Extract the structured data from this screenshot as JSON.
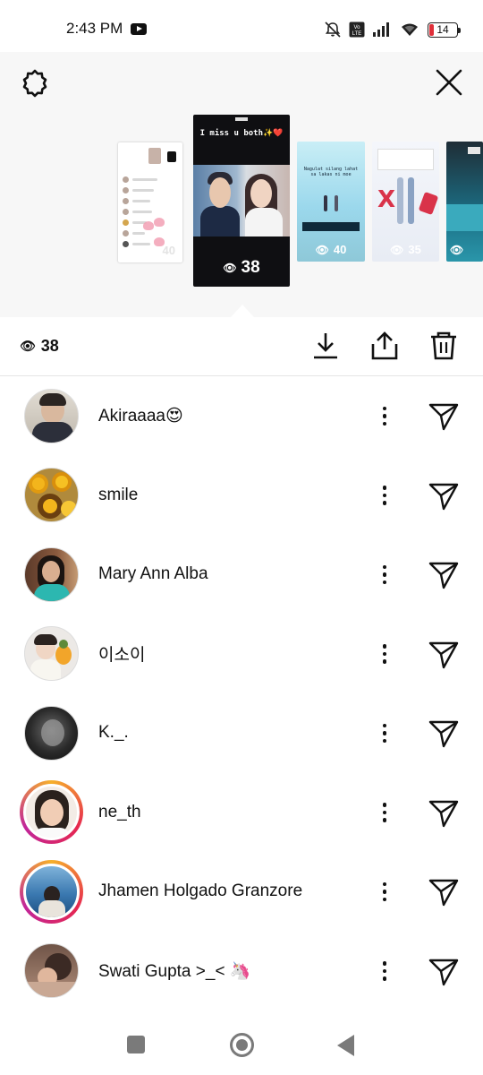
{
  "status_bar": {
    "time": "2:43 PM",
    "battery_level": "14",
    "icons": [
      "youtube-icon",
      "mute-icon",
      "volte-icon",
      "signal-icon",
      "wifi-icon",
      "battery-icon"
    ]
  },
  "header": {
    "settings_icon": "gear-icon",
    "close_icon": "close-icon"
  },
  "stories": [
    {
      "views": "40",
      "theme": "viewer-list-screenshot"
    },
    {
      "views": "38",
      "caption": "I miss u both✨❤️",
      "selected": true
    },
    {
      "views": "40",
      "caption": "Nagulat silang lahat sa lakas ni moe"
    },
    {
      "views": "35"
    },
    {
      "views": ""
    }
  ],
  "toolbar": {
    "views_count": "38",
    "icons": [
      "download-icon",
      "share-icon",
      "delete-icon"
    ]
  },
  "viewers": [
    {
      "name": "Akiraaaa😍",
      "ring": false
    },
    {
      "name": "smile",
      "ring": false
    },
    {
      "name": "Mary Ann Alba",
      "ring": false
    },
    {
      "name": "이소이",
      "ring": false
    },
    {
      "name": "K._.",
      "ring": false
    },
    {
      "name": "ne_th",
      "ring": true
    },
    {
      "name": "Jhamen Holgado Granzore",
      "ring": true
    },
    {
      "name": "Swati Gupta >_< 🦄",
      "ring": false
    }
  ],
  "colors": {
    "accent_ring": [
      "#f6b02b",
      "#e6274f",
      "#c1269a"
    ],
    "battery_low": "#e0303a"
  }
}
